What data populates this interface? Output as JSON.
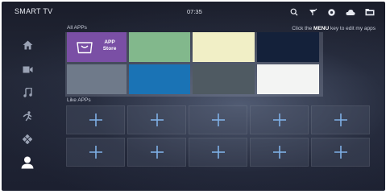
{
  "topbar": {
    "title": "SMART TV",
    "time": "07:35",
    "icons": [
      "search-icon",
      "antenna-icon",
      "settings-icon",
      "cloud-icon",
      "folder-icon"
    ]
  },
  "sidebar": {
    "items": [
      {
        "icon": "home-icon"
      },
      {
        "icon": "video-icon"
      },
      {
        "icon": "music-icon"
      },
      {
        "icon": "sports-icon"
      },
      {
        "icon": "apps-icon"
      },
      {
        "icon": "user-icon",
        "selected": true
      }
    ]
  },
  "all_apps": {
    "title": "All APPs",
    "hint_prefix": "Click the",
    "hint_key": "MENU",
    "hint_suffix": "key to edit my apps",
    "store_label_line1": "APP",
    "store_label_line2": "Store",
    "tile_colors": [
      "#7a4fa5",
      "#82b88c",
      "#f1efc6",
      "#14213a",
      "#6f7a8a",
      "#1a73b5",
      "#4f5a62",
      "#f3f4f3"
    ]
  },
  "like_apps": {
    "title": "Like APPs",
    "add_symbol": "+",
    "slots": 10
  },
  "colors": {
    "background": "#1f2333",
    "accent_purple": "#7a4fa5",
    "text": "#e8ebf2"
  }
}
